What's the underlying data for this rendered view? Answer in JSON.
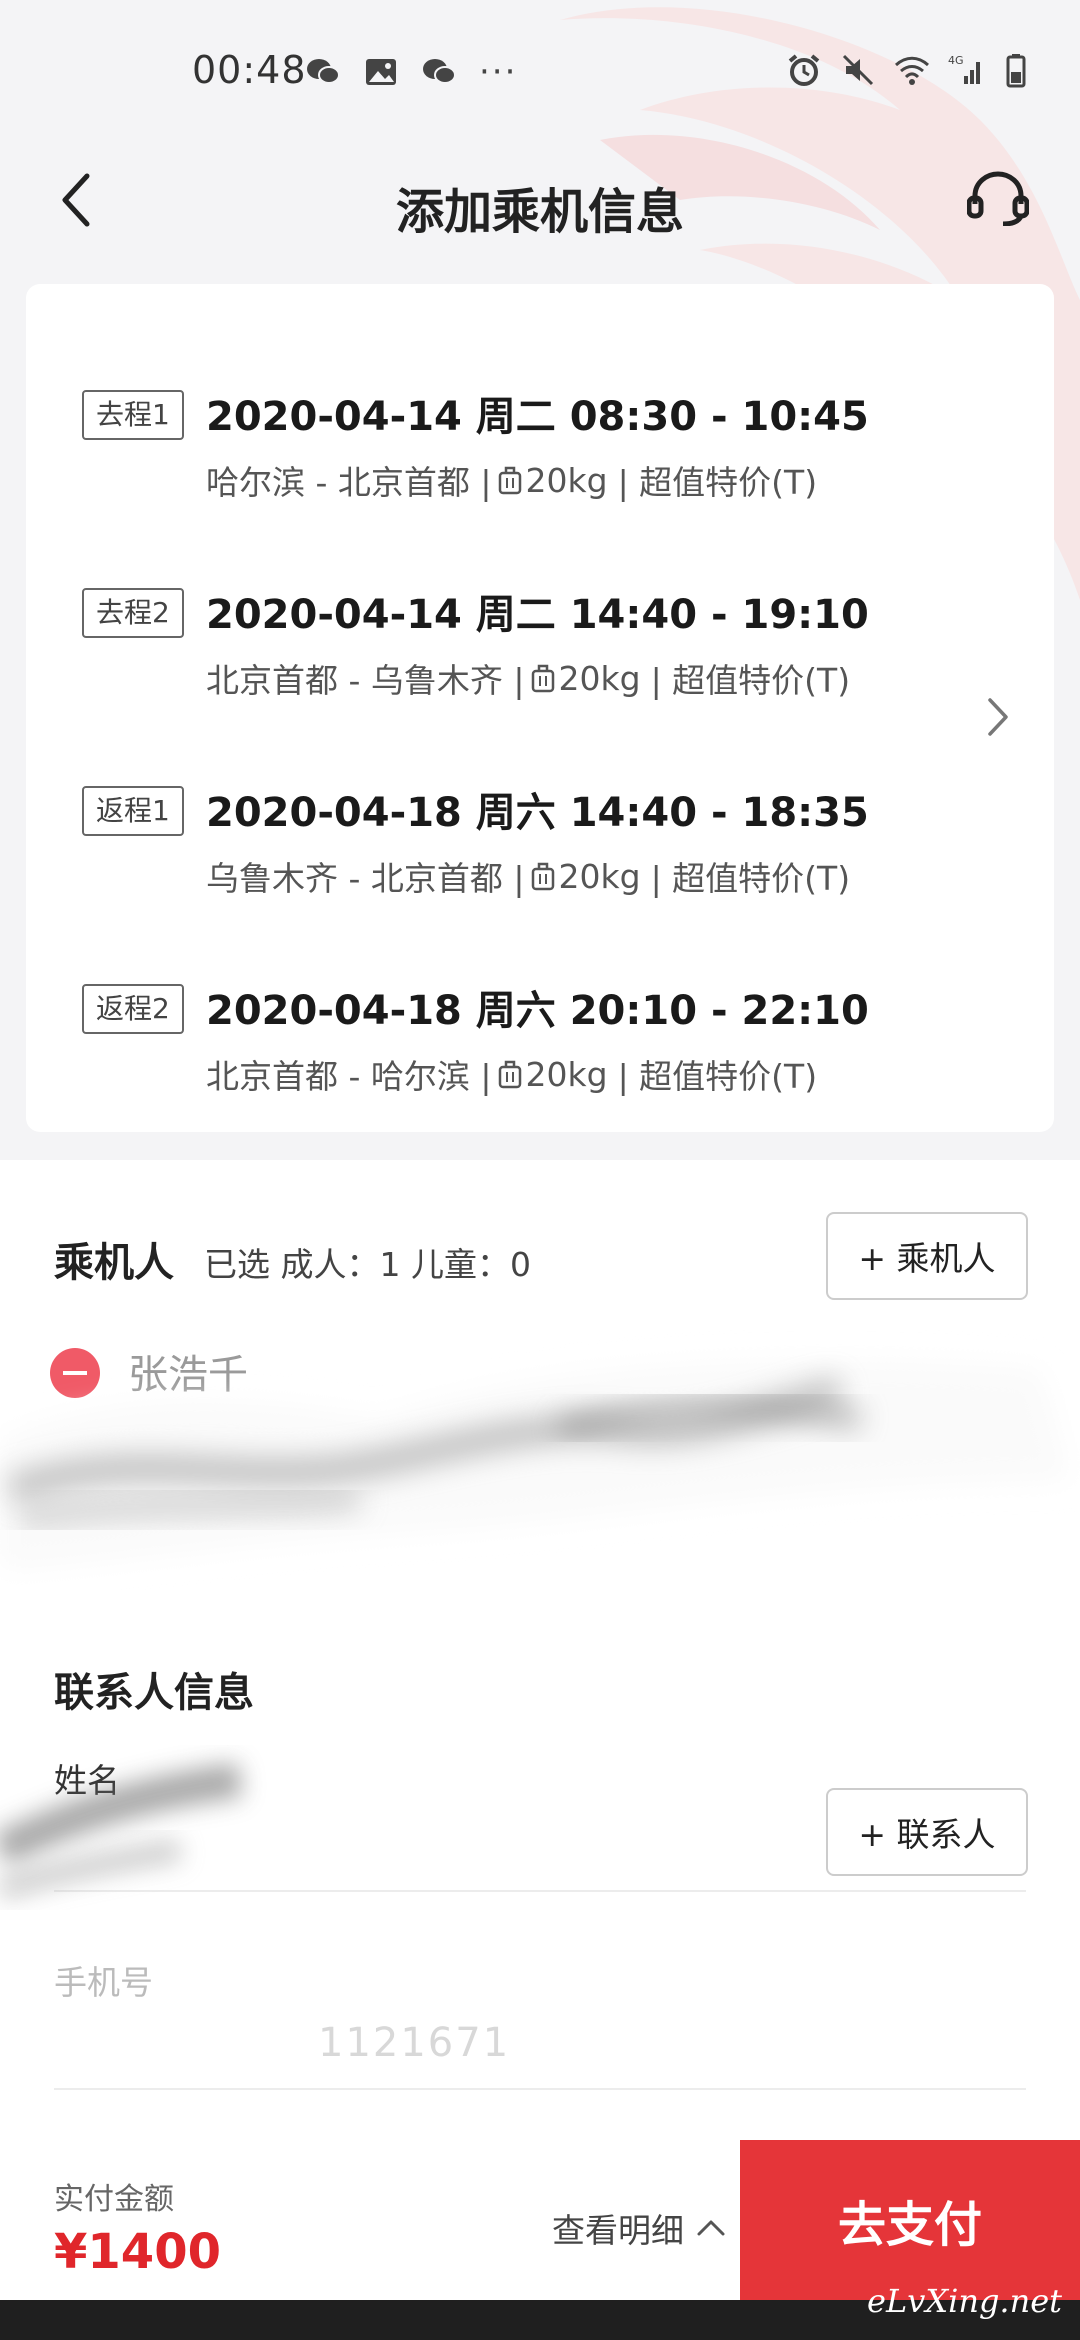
{
  "status_bar": {
    "time": "00:48",
    "left_icons": [
      "wechat-icon",
      "image-icon",
      "wechat-icon",
      "more-dots-icon"
    ],
    "right_icons": [
      "alarm-icon",
      "mute-icon",
      "wifi-icon",
      "signal-4g-icon",
      "battery-icon"
    ],
    "more_dots": "···"
  },
  "header": {
    "title": "添加乘机信息",
    "back_icon": "chevron-left-icon",
    "service_icon": "headset-icon"
  },
  "flights": [
    {
      "tag": "去程1",
      "date_time": "2020-04-14 周二  08:30 - 10:45",
      "route": "哈尔滨 - 北京首都 |",
      "baggage": "20kg",
      "fare": "| 超值特价(T)"
    },
    {
      "tag": "去程2",
      "date_time": "2020-04-14 周二  14:40 - 19:10",
      "route": "北京首都 - 乌鲁木齐 |",
      "baggage": "20kg",
      "fare": "| 超值特价(T)"
    },
    {
      "tag": "返程1",
      "date_time": "2020-04-18 周六  14:40 - 18:35",
      "route": "乌鲁木齐 - 北京首都 |",
      "baggage": "20kg",
      "fare": "| 超值特价(T)"
    },
    {
      "tag": "返程2",
      "date_time": "2020-04-18 周六  20:10 - 22:10",
      "route": "北京首都 - 哈尔滨 |",
      "baggage": "20kg",
      "fare": "| 超值特价(T)"
    }
  ],
  "passengers": {
    "title": "乘机人",
    "count_text": "已选 成人：1 儿童：0",
    "add_button": "+ 乘机人",
    "items": [
      {
        "name": "张浩千"
      }
    ]
  },
  "contact": {
    "title": "联系人信息",
    "name_label": "姓名",
    "add_button": "+ 联系人",
    "phone_label": "手机号",
    "phone_value": "1121671"
  },
  "footer": {
    "amount_label": "实付金额",
    "amount": "¥1400",
    "detail_link": "查看明细",
    "pay_button": "去支付",
    "watermark": "eLvXing.net"
  },
  "colors": {
    "accent": "#e53539",
    "price": "#e0262b",
    "remove": "#f05a67"
  }
}
